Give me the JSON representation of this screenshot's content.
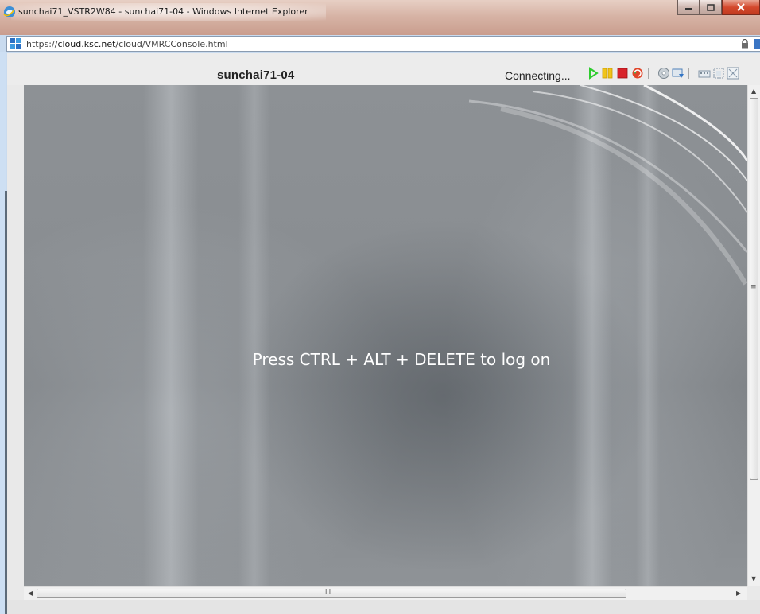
{
  "window": {
    "title": "sunchai71_VSTR2W84 - sunchai71-04 - Windows Internet Explorer",
    "icon": "ie-icon",
    "buttons": [
      "minimize-icon",
      "maximize-icon",
      "close-icon"
    ]
  },
  "address": {
    "prefix": "https://",
    "host": "cloud.ksc.net",
    "path": "/cloud/VMRCConsole.html",
    "icon": "site-icon",
    "secure_icon": "lock-icon"
  },
  "console": {
    "vm_name": "sunchai71-04",
    "status": "Connecting...",
    "toolbar_icons": [
      "play-icon",
      "pause-icon",
      "stop-icon",
      "reset-icon",
      "disc-icon",
      "send-keys-icon",
      "keyboard-icon",
      "fit-window-icon",
      "fullscreen-icon"
    ],
    "screen_message": "Press CTRL + ALT + DELETE to log on"
  },
  "scrollbars": {
    "vertical_grip": "≡",
    "horizontal_grip": "III"
  },
  "colors": {
    "play": "#2ecc2e",
    "pause": "#f0c419",
    "stop": "#d8232a",
    "screen_bg": "#8a8e92"
  }
}
